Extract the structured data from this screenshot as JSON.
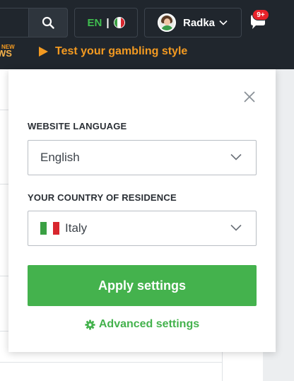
{
  "header": {
    "language_code": "EN",
    "language_separator": "|",
    "user_name": "Radka",
    "notification_badge": "9+",
    "promo_new": "NEW",
    "promo_left_text": "WS",
    "promo_link": "Test your gambling style"
  },
  "settings_panel": {
    "website_language_label": "WEBSITE LANGUAGE",
    "website_language_value": "English",
    "country_label": "YOUR COUNTRY OF RESIDENCE",
    "country_value": "Italy",
    "apply_label": "Apply settings",
    "advanced_label": "Advanced settings"
  },
  "colors": {
    "header_bg": "#20262d",
    "accent_green": "#44b24d",
    "promo_orange": "#f39a21",
    "badge_red": "#e8222a",
    "flag_green": "#3aa043",
    "flag_white": "#ffffff",
    "flag_red": "#d8262e"
  },
  "icons": {
    "search": "search-icon",
    "chevron": "chevron-down-icon",
    "close": "close-icon",
    "gear": "gear-icon",
    "notifications": "bell-chat-icon",
    "flag": "italy-flag-icon"
  }
}
